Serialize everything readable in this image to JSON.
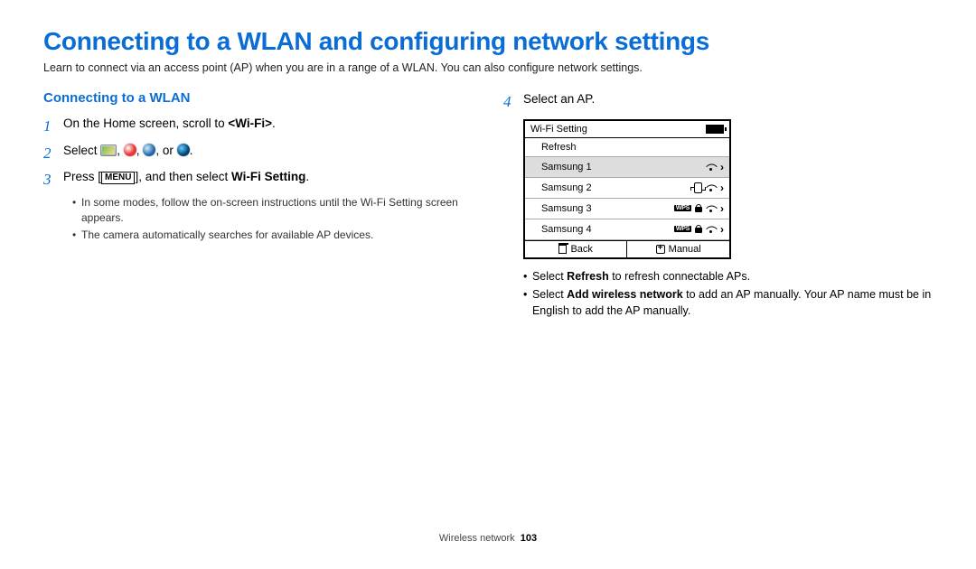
{
  "title": "Connecting to a WLAN and configuring network settings",
  "intro": "Learn to connect via an access point (AP) when you are in a range of a WLAN. You can also configure network settings.",
  "section_heading": "Connecting to a WLAN",
  "steps": {
    "s1": {
      "num": "1",
      "pre": "On the Home screen, scroll to ",
      "bold": "<Wi-Fi>",
      "post": "."
    },
    "s2": {
      "num": "2",
      "pre": "Select ",
      "sep": ", ",
      "or": ", or ",
      "post": "."
    },
    "s3": {
      "num": "3",
      "pre": "Press [",
      "menu": "MENU",
      "mid": "], and then select ",
      "bold": "Wi-Fi Setting",
      "post": "."
    },
    "s4": {
      "num": "4",
      "text": "Select an AP."
    }
  },
  "s3_bullets": [
    "In some modes, follow the on-screen instructions until the Wi-Fi Setting screen appears.",
    "The camera automatically searches for available AP devices."
  ],
  "panel": {
    "header": "Wi-Fi Setting",
    "refresh": "Refresh",
    "rows": [
      "Samsung 1",
      "Samsung 2",
      "Samsung 3",
      "Samsung 4"
    ],
    "back": "Back",
    "manual": "Manual"
  },
  "right_bullets": {
    "b1_pre": "Select ",
    "b1_bold": "Refresh",
    "b1_post": " to refresh connectable APs.",
    "b2_pre": "Select ",
    "b2_bold": "Add wireless network",
    "b2_post": " to add an AP manually. Your AP name must be in English to add the AP manually."
  },
  "footer_section": "Wireless network",
  "footer_page": "103"
}
